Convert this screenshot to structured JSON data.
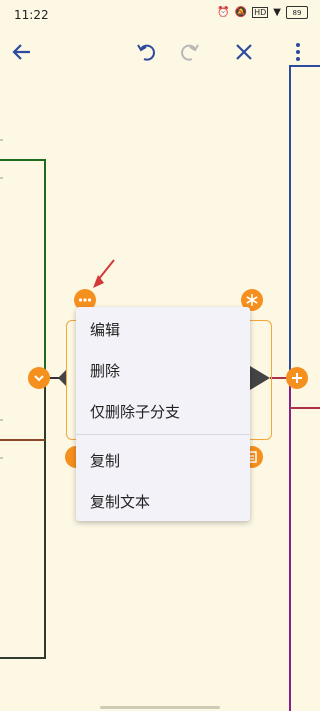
{
  "status": {
    "time": "11:22",
    "battery": "89"
  },
  "menu": {
    "items": [
      {
        "label": "编辑"
      },
      {
        "label": "删除"
      },
      {
        "label": "仅删除子分支"
      },
      {
        "label": "复制"
      },
      {
        "label": "复制文本"
      }
    ]
  },
  "colors": {
    "accent": "#f5901e",
    "toolbar_icon": "#2e4a9e",
    "disabled_icon": "#b8b8b8"
  },
  "icons": {
    "back": "back-arrow-icon",
    "undo": "undo-icon",
    "redo": "redo-icon",
    "close": "close-icon",
    "more": "more-vertical-icon"
  }
}
